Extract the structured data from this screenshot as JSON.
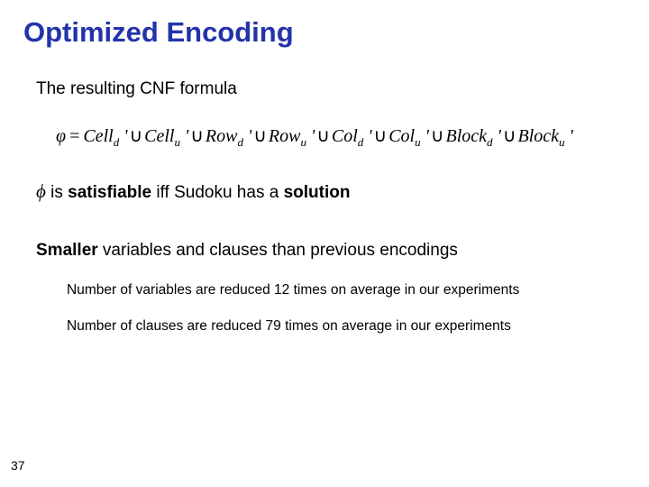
{
  "title": "Optimized Encoding",
  "intro": "The resulting CNF formula",
  "formula": {
    "lhs": "φ",
    "eq": "=",
    "terms": [
      {
        "base": "Cell",
        "sub": "d",
        "prime": true
      },
      {
        "base": "Cell",
        "sub": "u",
        "prime": true
      },
      {
        "base": "Row",
        "sub": "d",
        "prime": true
      },
      {
        "base": "Row",
        "sub": "u",
        "prime": true
      },
      {
        "base": "Col",
        "sub": "d",
        "prime": true
      },
      {
        "base": "Col",
        "sub": "u",
        "prime": true
      },
      {
        "base": "Block",
        "sub": "d",
        "prime": true
      },
      {
        "base": "Block",
        "sub": "u",
        "prime": true
      }
    ],
    "join": "∪"
  },
  "sat_phi": "ϕ",
  "sat_pre": " is ",
  "sat_bold": "satisfiable",
  "sat_mid": " iff Sudoku has a ",
  "sat_bold2": "solution",
  "smaller_bold": "Smaller",
  "smaller_rest": " variables and clauses than previous encodings",
  "sub1": "Number of variables are reduced 12 times on average in our experiments",
  "sub2": "Number of clauses are reduced 79 times on average in our experiments",
  "page": "37"
}
